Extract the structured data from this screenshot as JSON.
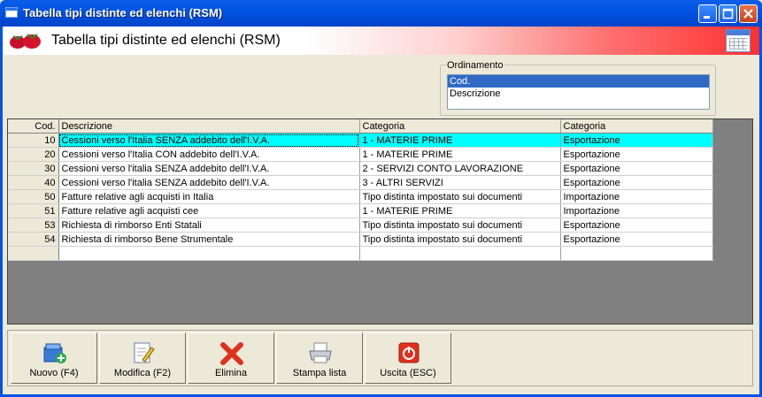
{
  "window": {
    "title": "Tabella tipi distinte ed elenchi (RSM)"
  },
  "header": {
    "title": "Tabella tipi distinte ed elenchi (RSM)"
  },
  "ordinamento": {
    "legend": "Ordinamento",
    "options": [
      "Cod.",
      "Descrizione"
    ],
    "selected": "Cod."
  },
  "table": {
    "columns": [
      "Cod.",
      "Descrizione",
      "Categoria",
      "Categoria"
    ],
    "rows": [
      [
        "10",
        "Cessioni verso l'Italia SENZA addebito dell'I.V.A.",
        "1 - MATERIE PRIME",
        "Esportazione"
      ],
      [
        "20",
        "Cessioni verso l'Italia CON addebito dell'I.V.A.",
        "1 - MATERIE PRIME",
        "Esportazione"
      ],
      [
        "30",
        "Cessioni verso l'italia SENZA addebito dell'I.V.A.",
        "2 - SERVIZI CONTO LAVORAZIONE",
        "Esportazione"
      ],
      [
        "40",
        "Cessioni verso l'italia SENZA addebito dell'I.V.A.",
        "3 - ALTRI SERVIZI",
        "Esportazione"
      ],
      [
        "50",
        "Fatture relative agli acquisti in Italia",
        "Tipo distinta impostato sui documenti",
        "Importazione"
      ],
      [
        "51",
        "Fatture relative agli acquisti cee",
        "1 - MATERIE PRIME",
        "Importazione"
      ],
      [
        "53",
        "Richiesta di rimborso Enti Statali",
        "Tipo distinta impostato sui documenti",
        "Esportazione"
      ],
      [
        "54",
        "Richiesta di rimborso Bene Strumentale",
        "Tipo distinta impostato sui documenti",
        "Esportazione"
      ]
    ],
    "selected_row": 0
  },
  "toolbar": {
    "new_label": "Nuovo (F4)",
    "edit_label": "Modifica (F2)",
    "delete_label": "Elimina",
    "print_label": "Stampa lista",
    "exit_label": "Uscita (ESC)"
  },
  "colors": {
    "titlebar": "#0054e3",
    "selected_row": "#00ffff",
    "list_selection": "#316ac5"
  }
}
